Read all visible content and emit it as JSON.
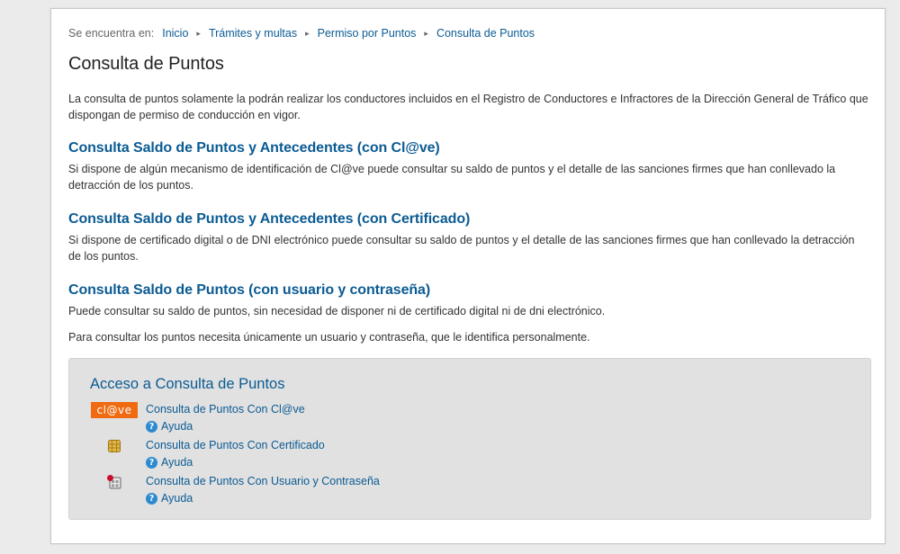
{
  "breadcrumb": {
    "prefix": "Se encuentra en:",
    "items": [
      "Inicio",
      "Trámites y multas",
      "Permiso por Puntos",
      "Consulta de Puntos"
    ]
  },
  "page_title": "Consulta de Puntos",
  "intro": "La consulta de puntos solamente la podrán realizar los conductores incluidos en el Registro de Conductores e Infractores de la Dirección General de Tráfico que dispongan de permiso de conducción en vigor.",
  "sections": [
    {
      "title": "Consulta Saldo de Puntos y Antecedentes (con Cl@ve)",
      "paragraphs": [
        "Si dispone de algún mecanismo de identificación de Cl@ve puede consultar su saldo de puntos y el detalle de las sanciones firmes que han conllevado la detracción de los puntos."
      ]
    },
    {
      "title": "Consulta Saldo de Puntos y Antecedentes (con Certificado)",
      "paragraphs": [
        "Si dispone de certificado digital o de DNI electrónico puede consultar su saldo de puntos y el detalle de las sanciones firmes que han conllevado la detracción de los puntos."
      ]
    },
    {
      "title": "Consulta Saldo de Puntos (con usuario y contraseña)",
      "paragraphs": [
        "Puede consultar su saldo de puntos, sin necesidad de disponer ni de certificado digital ni de dni electrónico.",
        "Para consultar los puntos necesita únicamente un usuario y contraseña, que le identifica personalmente."
      ]
    }
  ],
  "access": {
    "title": "Acceso a Consulta de Puntos",
    "clave_logo_text": "cl@ve",
    "rows": [
      {
        "icon": "clave-logo",
        "link": "Consulta de Puntos Con Cl@ve",
        "help": "Ayuda"
      },
      {
        "icon": "certificate-chip-icon",
        "link": "Consulta de Puntos Con Certificado",
        "help": "Ayuda"
      },
      {
        "icon": "user-password-card-icon",
        "link": "Consulta de Puntos Con Usuario y Contraseña",
        "help": "Ayuda"
      }
    ]
  },
  "colors": {
    "link_blue": "#0b5b93",
    "clave_orange": "#f06a11",
    "help_blue": "#2c8ad1",
    "access_bg": "#e1e1e1"
  }
}
